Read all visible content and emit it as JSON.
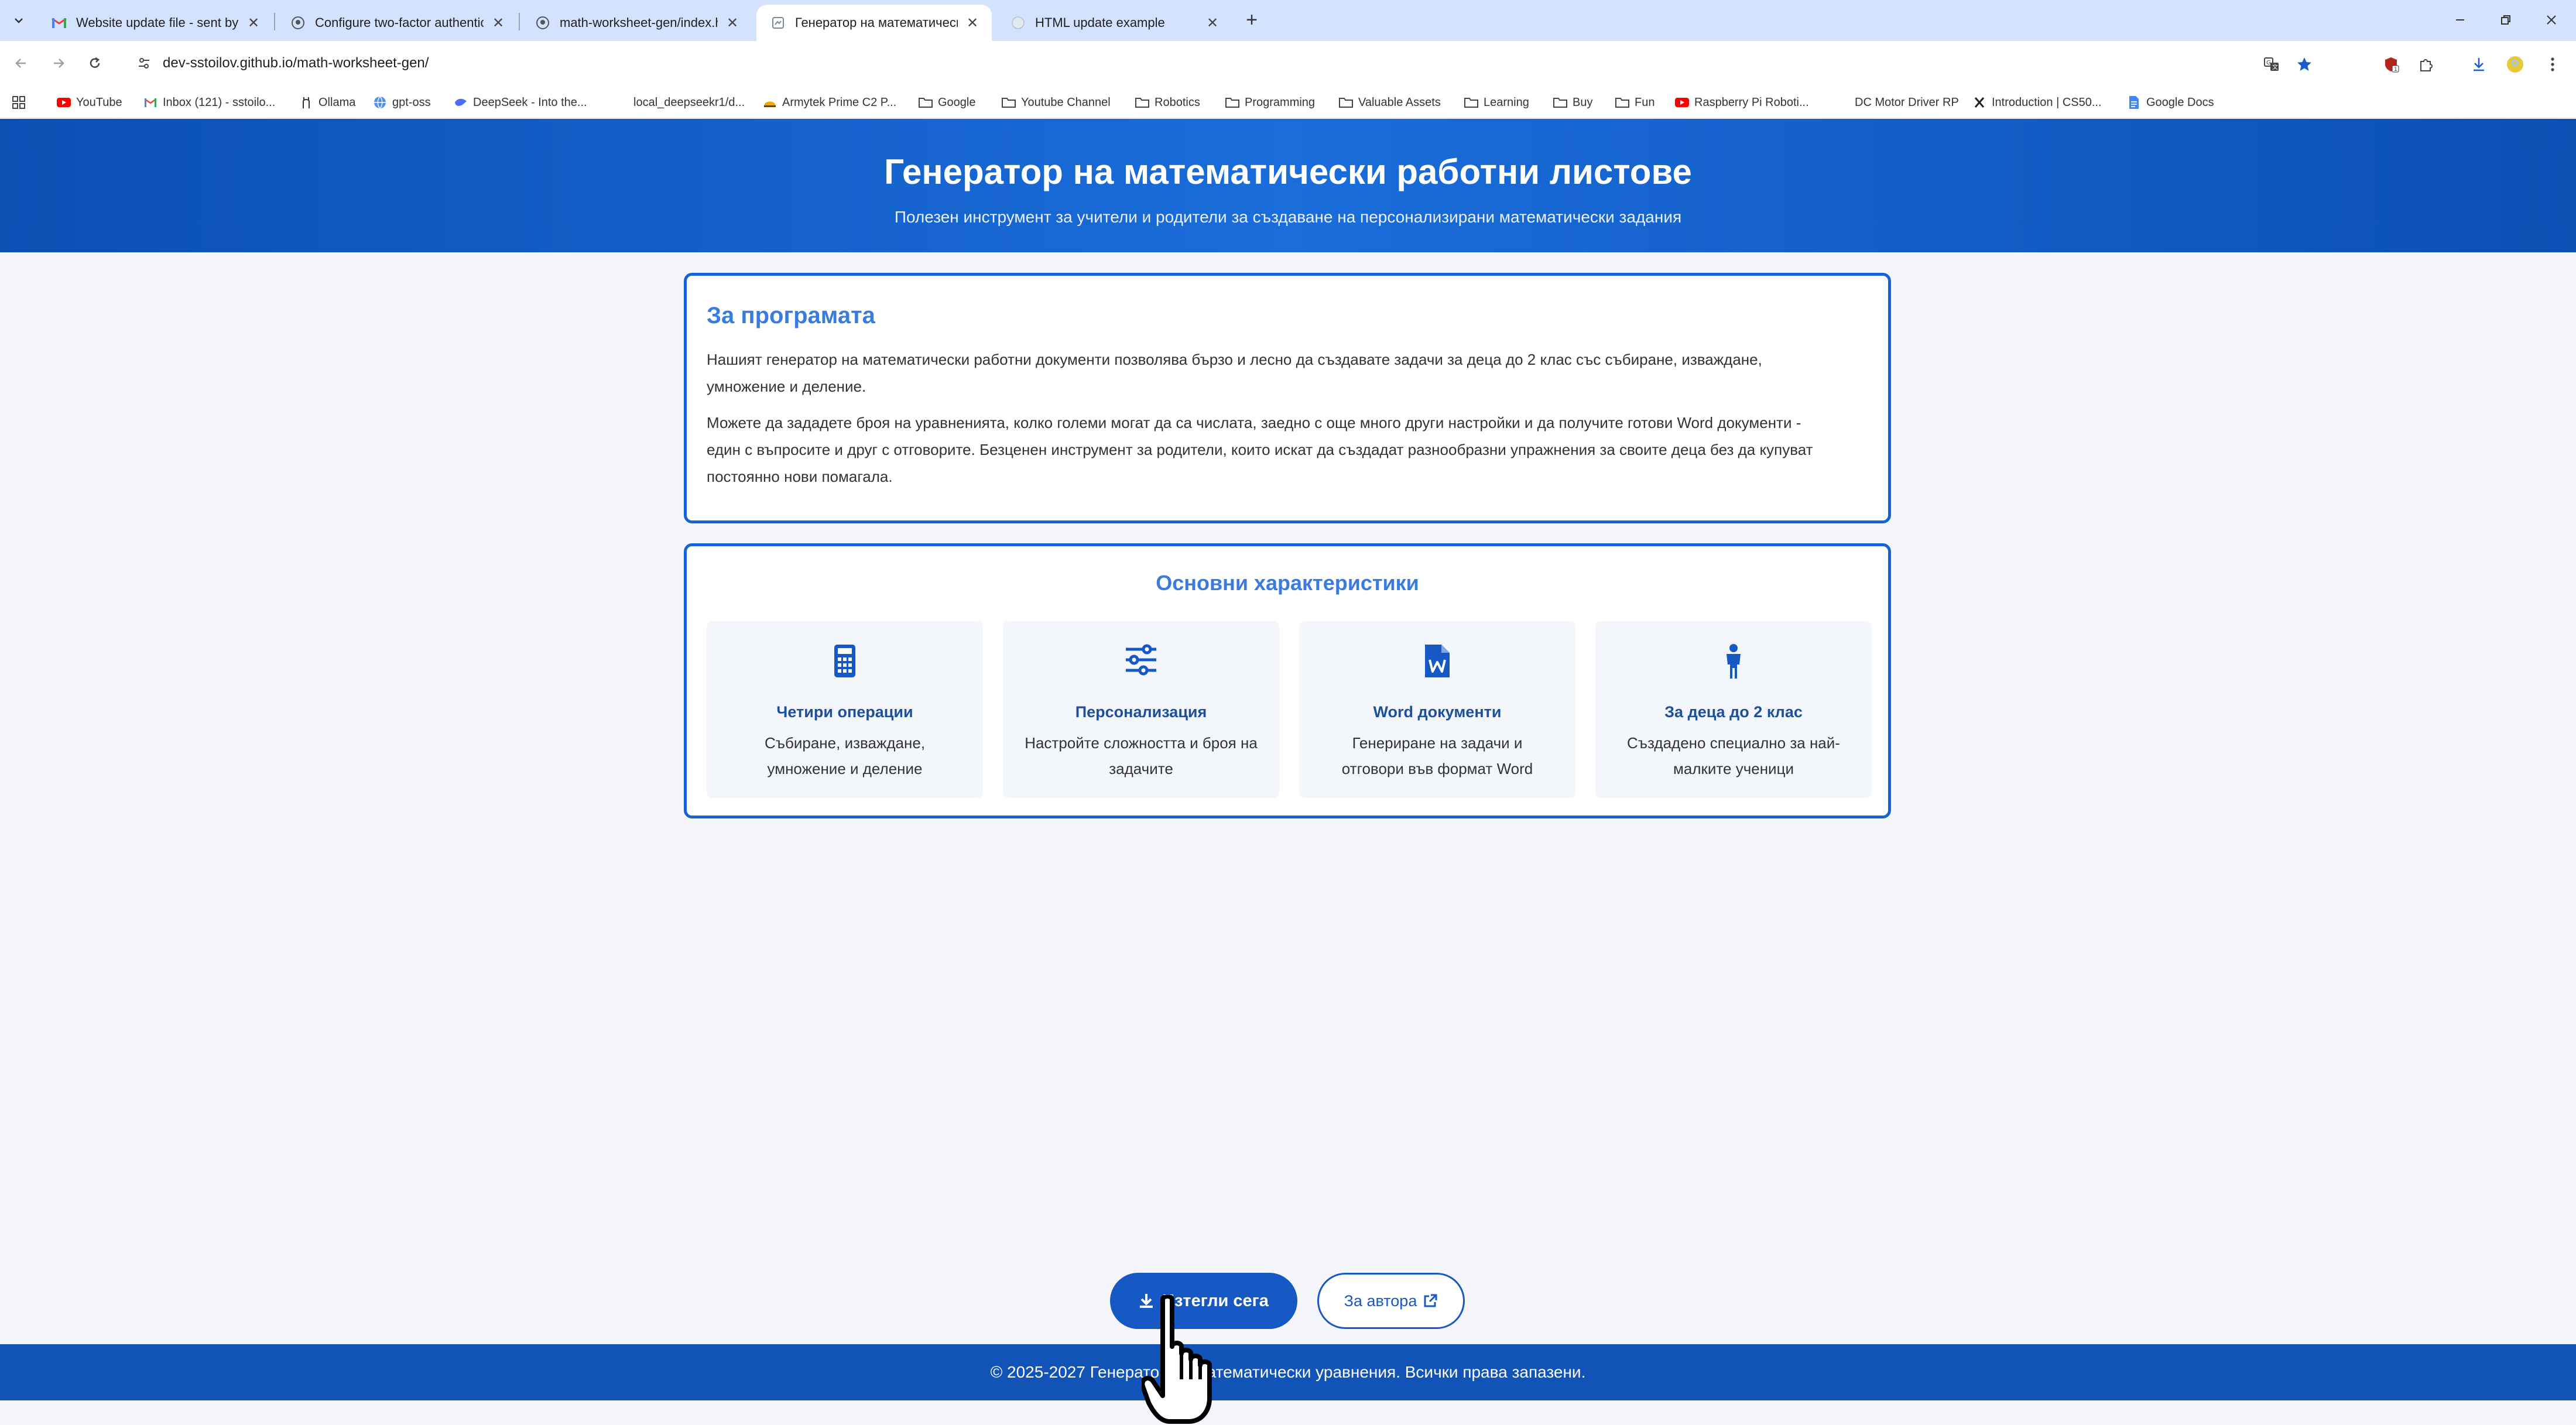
{
  "browser": {
    "tabs": [
      {
        "title": "Website update file - sent by st",
        "icon": "gmail-icon",
        "active": false
      },
      {
        "title": "Configure two-factor authentic",
        "icon": "github-icon",
        "active": false
      },
      {
        "title": "math-worksheet-gen/index.htm",
        "icon": "github-icon",
        "active": false
      },
      {
        "title": "Генератор на математически р",
        "icon": "page-icon",
        "active": true
      },
      {
        "title": "HTML update example",
        "icon": "globe-icon",
        "active": false
      }
    ],
    "url": "dev-sstoilov.github.io/math-worksheet-gen/",
    "bookmarks": [
      {
        "label": "YouTube",
        "icon": "youtube-icon"
      },
      {
        "label": "Inbox (121) - sstoilo...",
        "icon": "gmail-icon"
      },
      {
        "label": "Ollama",
        "icon": "ollama-icon"
      },
      {
        "label": "gpt-oss",
        "icon": "globe-icon"
      },
      {
        "label": "DeepSeek - Into the...",
        "icon": "deepseek-icon"
      },
      {
        "label": "local_deepseekr1/d...",
        "icon": "blank-icon"
      },
      {
        "label": "Armytek Prime C2 P...",
        "icon": "armytek-icon"
      },
      {
        "label": "Google",
        "icon": "folder-icon"
      },
      {
        "label": "Youtube Channel",
        "icon": "folder-icon"
      },
      {
        "label": "Robotics",
        "icon": "folder-icon"
      },
      {
        "label": "Programming",
        "icon": "folder-icon"
      },
      {
        "label": "Valuable Assets",
        "icon": "folder-icon"
      },
      {
        "label": "Learning",
        "icon": "folder-icon"
      },
      {
        "label": "Buy",
        "icon": "folder-icon"
      },
      {
        "label": "Fun",
        "icon": "folder-icon"
      },
      {
        "label": "Raspberry Pi Roboti...",
        "icon": "youtube-icon"
      },
      {
        "label": "DC Motor Driver RP",
        "icon": "blank-icon"
      },
      {
        "label": "Introduction | CS50...",
        "icon": "x-icon"
      },
      {
        "label": "Google Docs",
        "icon": "docs-icon"
      }
    ]
  },
  "hero": {
    "title": "Генератор на математически работни листове",
    "subtitle": "Полезен инструмент за учители и родители за създаване на персонализирани математически задания"
  },
  "about": {
    "heading": "За програмата",
    "p1_line1": "Нашият генератор на математически работни документи позволява бързо и лесно да създавате задачи за деца до 2 клас със събиране, изваждане,",
    "p1_line2": "умножение и деление.",
    "p2_line1": "Можете да зададете броя на уравненията, колко големи могат да са числата, заедно с още много други настройки и да получите готови Word документи -",
    "p2_line2": "един с въпросите и друг с отговорите. Безценен инструмент за родители, които искат да създадат разнообразни упражнения за своите деца без да купуват",
    "p2_line3": "постоянно нови помагала."
  },
  "features": {
    "heading": "Основни характеристики",
    "items": [
      {
        "icon": "calculator-icon",
        "title": "Четири операции",
        "line1": "Събиране, изваждане,",
        "line2": "умножение и деление"
      },
      {
        "icon": "sliders-icon",
        "title": "Персонализация",
        "line1": "Настройте сложността и броя на",
        "line2": "задачите"
      },
      {
        "icon": "word-document-icon",
        "title": "Word документи",
        "line1": "Генериране на задачи и",
        "line2": "отговори във формат Word"
      },
      {
        "icon": "child-icon",
        "title": "За деца до 2 клас",
        "line1": "Създадено специално за най-",
        "line2": "малките ученици"
      }
    ]
  },
  "actions": {
    "download_label": "Изтегли сега",
    "author_label": "За автора"
  },
  "footer": {
    "text": "© 2025-2027 Генератор на математически уравнения. Всички права запазени."
  },
  "colors": {
    "brand_blue": "#1659c4",
    "heading_blue": "#3a7be0",
    "footer_blue": "#1253b8"
  }
}
